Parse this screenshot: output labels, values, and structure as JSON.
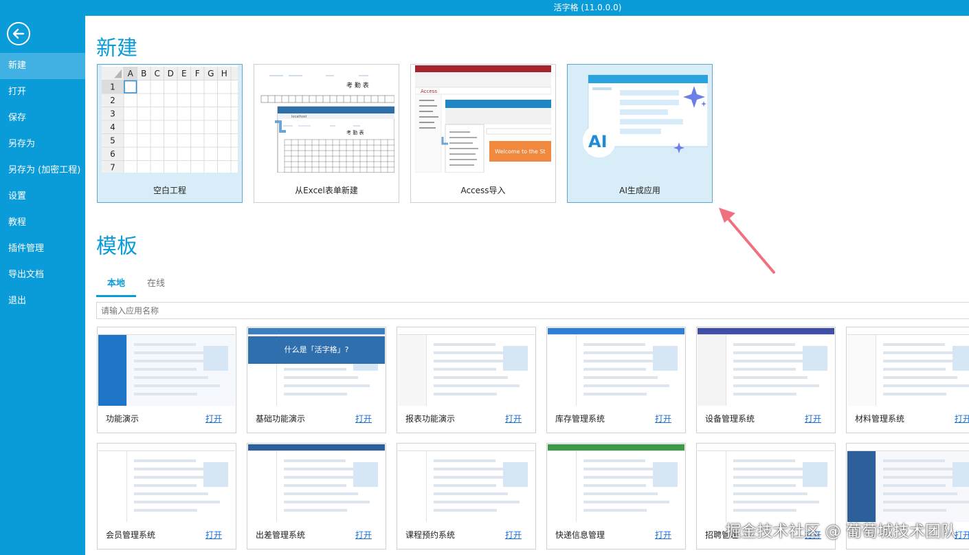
{
  "window": {
    "title": "活字格 (11.0.0.0)"
  },
  "sidebar": {
    "items": [
      {
        "label": "新建",
        "name": "sidebar-item-new",
        "active": true
      },
      {
        "label": "打开",
        "name": "sidebar-item-open"
      },
      {
        "label": "保存",
        "name": "sidebar-item-save"
      },
      {
        "label": "另存为",
        "name": "sidebar-item-save-as"
      },
      {
        "label": "另存为 (加密工程)",
        "name": "sidebar-item-save-as-encrypted"
      },
      {
        "label": "设置",
        "name": "sidebar-item-settings"
      },
      {
        "label": "教程",
        "name": "sidebar-item-tutorial"
      },
      {
        "label": "插件管理",
        "name": "sidebar-item-plugins"
      },
      {
        "label": "导出文档",
        "name": "sidebar-item-export-doc"
      },
      {
        "label": "退出",
        "name": "sidebar-item-exit"
      }
    ]
  },
  "new_section": {
    "title": "新建",
    "cards": [
      {
        "label": "空白工程",
        "name": "blank-project-card",
        "selected": true
      },
      {
        "label": "从Excel表单新建",
        "name": "excel-new-card"
      },
      {
        "label": "Access导入",
        "name": "access-import-card"
      },
      {
        "label": "AI生成应用",
        "name": "ai-generate-card",
        "selected": true
      }
    ],
    "grid_columns": [
      "A",
      "B",
      "C",
      "D",
      "E",
      "F",
      "G",
      "H"
    ],
    "grid_rows": [
      "1",
      "2",
      "3",
      "4",
      "5",
      "6",
      "7"
    ],
    "excel_thumb": {
      "title": "考 勤 表",
      "url": "localhost"
    },
    "access_thumb": {
      "banner": "Welcome to the St",
      "app": "Access"
    },
    "ai_thumb": {
      "text": "AI"
    }
  },
  "template_section": {
    "title": "模板",
    "tabs": [
      {
        "label": "本地",
        "active": true
      },
      {
        "label": "在线"
      }
    ],
    "search_placeholder": "请输入应用名称",
    "open_label": "打开",
    "templates": [
      {
        "name": "功能演示"
      },
      {
        "name": "基础功能演示",
        "banner": "什么是「活字格」?"
      },
      {
        "name": "报表功能演示"
      },
      {
        "name": "库存管理系统"
      },
      {
        "name": "设备管理系统"
      },
      {
        "name": "材料管理系统"
      },
      {
        "name": "会员管理系统"
      },
      {
        "name": "出差管理系统"
      },
      {
        "name": "课程预约系统"
      },
      {
        "name": "快递信息管理"
      },
      {
        "name": "招聘管理"
      },
      {
        "name": ""
      }
    ]
  },
  "watermark": "掘金技术社区 @ 葡萄城技术团队",
  "colors": {
    "accent": "#0a9bd9",
    "arrow": "#f07080",
    "link": "#1a6fd8"
  }
}
